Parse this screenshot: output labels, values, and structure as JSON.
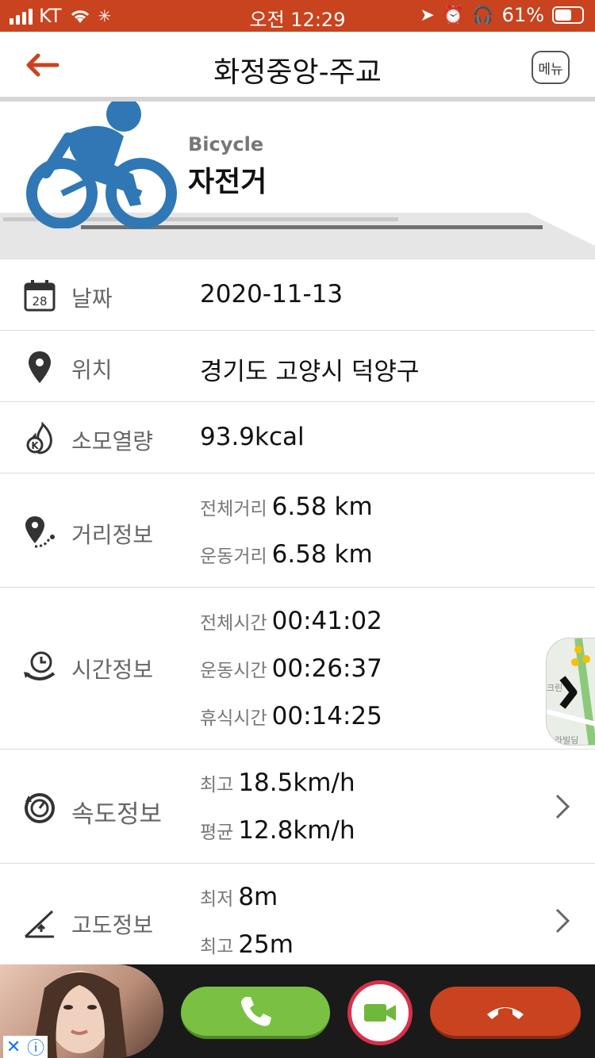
{
  "status_bar": {
    "carrier": "KT",
    "time": "오전 12:29",
    "battery": "61%",
    "battery_level": 0.61
  },
  "header": {
    "title": "화정중앙-주교",
    "menu_label": "메뉴"
  },
  "activity": {
    "subtitle": "Bicycle",
    "name": "자전거"
  },
  "rows": {
    "date": {
      "label": "날짜",
      "value": "2020-11-13",
      "icon_text": "28"
    },
    "location": {
      "label": "위치",
      "value": "경기도 고양시 덕양구"
    },
    "calories": {
      "label": "소모열량",
      "value": "93.9kcal"
    },
    "distance": {
      "label": "거리정보",
      "items": [
        {
          "key": "전체거리",
          "value": "6.58 km"
        },
        {
          "key": "운동거리",
          "value": "6.58 km"
        }
      ]
    },
    "time": {
      "label": "시간정보",
      "items": [
        {
          "key": "전체시간",
          "value": "00:41:02"
        },
        {
          "key": "운동시간",
          "value": "00:26:37"
        },
        {
          "key": "휴식시간",
          "value": "00:14:25"
        }
      ]
    },
    "speed": {
      "label": "속도정보",
      "items": [
        {
          "key": "최고",
          "value": "18.5km/h"
        },
        {
          "key": "평균",
          "value": "12.8km/h"
        }
      ]
    },
    "altitude": {
      "label": "고도정보",
      "items": [
        {
          "key": "최저",
          "value": "8m"
        },
        {
          "key": "최고",
          "value": "25m"
        }
      ]
    }
  },
  "map_thumb": {
    "labels": [
      "크린",
      "라빌딩"
    ]
  },
  "colors": {
    "brand": "#c9431f",
    "bike_blue": "#2f78b5",
    "accept": "#7ac143",
    "decline": "#c9431f"
  }
}
